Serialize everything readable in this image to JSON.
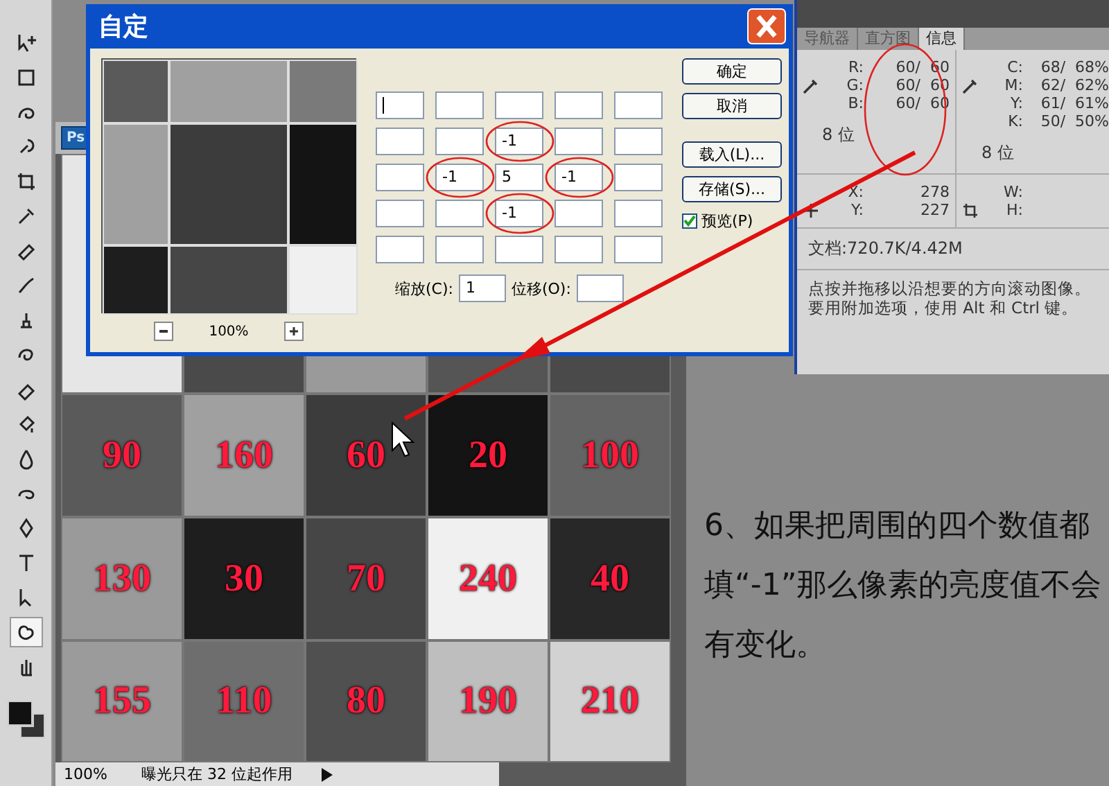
{
  "toolbar": {
    "tools": [
      {
        "selected": false
      },
      {
        "selected": false
      },
      {
        "selected": false
      },
      {
        "selected": false
      },
      {
        "selected": false
      },
      {
        "selected": false
      },
      {
        "selected": false
      },
      {
        "selected": false
      },
      {
        "selected": false
      },
      {
        "selected": false
      },
      {
        "selected": false
      },
      {
        "selected": false
      },
      {
        "selected": false
      },
      {
        "selected": false
      },
      {
        "selected": false
      },
      {
        "selected": false
      },
      {
        "selected": false
      },
      {
        "selected": true
      },
      {
        "selected": false
      }
    ]
  },
  "document": {
    "tab_label": "Ps",
    "rows": [
      [
        "90",
        "160",
        "60",
        "20",
        "100"
      ],
      [
        "130",
        "30",
        "70",
        "240",
        "40"
      ],
      [
        "155",
        "110",
        "80",
        "190",
        "210"
      ]
    ],
    "status": {
      "zoom": "100%",
      "message": "曝光只在 32 位起作用"
    }
  },
  "dialog": {
    "title": "自定",
    "preview_zoom": "100%",
    "kernel": [
      [
        {
          "focused": true,
          "circled": false
        },
        {
          "circled": false
        },
        {
          "circled": false
        },
        {
          "circled": false
        },
        {
          "circled": false
        }
      ],
      [
        {
          "circled": false
        },
        {
          "circled": false
        },
        {
          "value": "-1",
          "circled": true
        },
        {
          "circled": false
        },
        {
          "circled": false
        }
      ],
      [
        {
          "circled": false
        },
        {
          "value": "-1",
          "circled": true
        },
        {
          "value": "5",
          "circled": false
        },
        {
          "value": "-1",
          "circled": true
        },
        {
          "circled": false
        }
      ],
      [
        {
          "circled": false
        },
        {
          "circled": false
        },
        {
          "value": "-1",
          "circled": true
        },
        {
          "circled": false
        },
        {
          "circled": false
        }
      ],
      [
        {
          "circled": false
        },
        {
          "circled": false
        },
        {
          "circled": false
        },
        {
          "circled": false
        },
        {
          "circled": false
        }
      ]
    ],
    "scale": {
      "label": "缩放(C):",
      "value": "1"
    },
    "offset": {
      "label": "位移(O):"
    },
    "buttons": [
      "确定",
      "取消",
      "载入(L)...",
      "存储(S)..."
    ],
    "preview": {
      "label": "预览(P)",
      "checked": true
    }
  },
  "info_panel": {
    "tabs": [
      {
        "label": "导航器",
        "selected": false
      },
      {
        "label": "直方图",
        "selected": false
      },
      {
        "label": "信息",
        "selected": true
      }
    ],
    "rgb": [
      {
        "label": "R:",
        "value": "60/  60"
      },
      {
        "label": "G:",
        "value": "60/  60"
      },
      {
        "label": "B:",
        "value": "60/  60"
      }
    ],
    "rgb_circled": true,
    "cmyk": [
      {
        "label": "C:",
        "value": "68/  68%"
      },
      {
        "label": "M:",
        "value": "62/  62%"
      },
      {
        "label": "Y:",
        "value": "61/  61%"
      },
      {
        "label": "K:",
        "value": "50/  50%"
      }
    ],
    "rgb_bits": "8 位",
    "cmyk_bits": "8 位",
    "position": [
      {
        "label": "X:",
        "value": "278"
      },
      {
        "label": "Y:",
        "value": "227"
      }
    ],
    "size": [
      {
        "label": "W:"
      },
      {
        "label": "H:"
      }
    ],
    "document_size": "文档:720.7K/4.42M",
    "hint": "点按并拖移以沿想要的方向滚动图像。要用附加选项，使用 Alt 和 Ctrl 键。"
  },
  "annotation": "6、如果把周围的四个数值都填“-1”那么像素的亮度值不会有变化。"
}
